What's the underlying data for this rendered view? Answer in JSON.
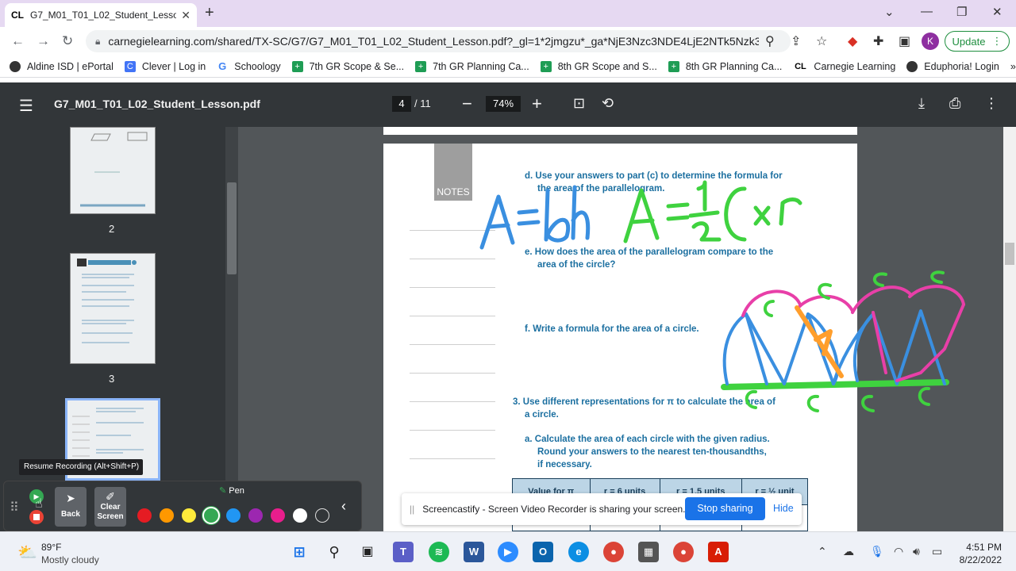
{
  "browser": {
    "tab_title": "G7_M01_T01_L02_Student_Lesso",
    "tab_favicon": "CL",
    "url": "carnegielearning.com/shared/TX-SC/G7/G7_M01_T01_L02_Student_Lesson.pdf?_gl=1*2jmgzu*_ga*NjE3Nzc3NDE4LjE2NTk5Nzk3...",
    "profile_initial": "K",
    "update_label": "Update",
    "bookmarks": [
      {
        "label": "Aldine ISD | ePortal",
        "icon": "globe-icon"
      },
      {
        "label": "Clever | Log in",
        "icon": "clever-icon"
      },
      {
        "label": "Schoology",
        "icon": "google-icon"
      },
      {
        "label": "7th GR Scope & Se...",
        "icon": "sheets-icon"
      },
      {
        "label": "7th GR Planning Ca...",
        "icon": "sheets-icon"
      },
      {
        "label": "8th GR Scope and S...",
        "icon": "sheets-icon"
      },
      {
        "label": "8th GR Planning Ca...",
        "icon": "sheets-icon"
      },
      {
        "label": "Carnegie Learning",
        "icon": "cl-icon"
      },
      {
        "label": "Eduphoria! Login",
        "icon": "globe-icon"
      }
    ],
    "bookmarks_more": "»"
  },
  "pdf": {
    "title": "G7_M01_T01_L02_Student_Lesson.pdf",
    "current_page": "4",
    "total_pages": "/ 11",
    "zoom": "74%",
    "thumbnails": [
      {
        "number": "2"
      },
      {
        "number": "3"
      }
    ]
  },
  "document": {
    "notes_label": "NOTES",
    "q_d": "d.  Use your answers to part (c) to determine the formula for",
    "q_d2": "the area of the parallelogram.",
    "q_e": "e.  How does the area of the parallelogram compare to the",
    "q_e2": "area of the circle?",
    "q_f": "f.  Write a formula for the area of a circle.",
    "q_3": "3.  Use different representations for π to calculate the area of",
    "q_3b": "a circle.",
    "q_a": "a.  Calculate the area of each circle with the given radius.",
    "q_a2": "Round your answers to the nearest ten-thousandths,",
    "q_a3": "if necessary.",
    "table_headers": [
      "Value for π",
      "r = 6 units",
      "r = 1.5 units",
      "r = ½ unit"
    ]
  },
  "screencastify": {
    "tooltip": "Resume Recording (Alt+Shift+P)",
    "back_label": "Back",
    "clear_label": "Clear Screen",
    "pen_label": "Pen",
    "colors": [
      "#e51c23",
      "#ff9800",
      "#ffeb3b",
      "#34a853",
      "#2196f3",
      "#9c27b0",
      "#e91e8c",
      "#ffffff",
      "transparent"
    ],
    "share_text": "Screencastify - Screen Video Recorder is sharing your screen.",
    "stop_sharing": "Stop sharing",
    "hide": "Hide"
  },
  "taskbar": {
    "temperature": "89°F",
    "weather": "Mostly cloudy",
    "time": "4:51 PM",
    "date": "8/22/2022"
  }
}
